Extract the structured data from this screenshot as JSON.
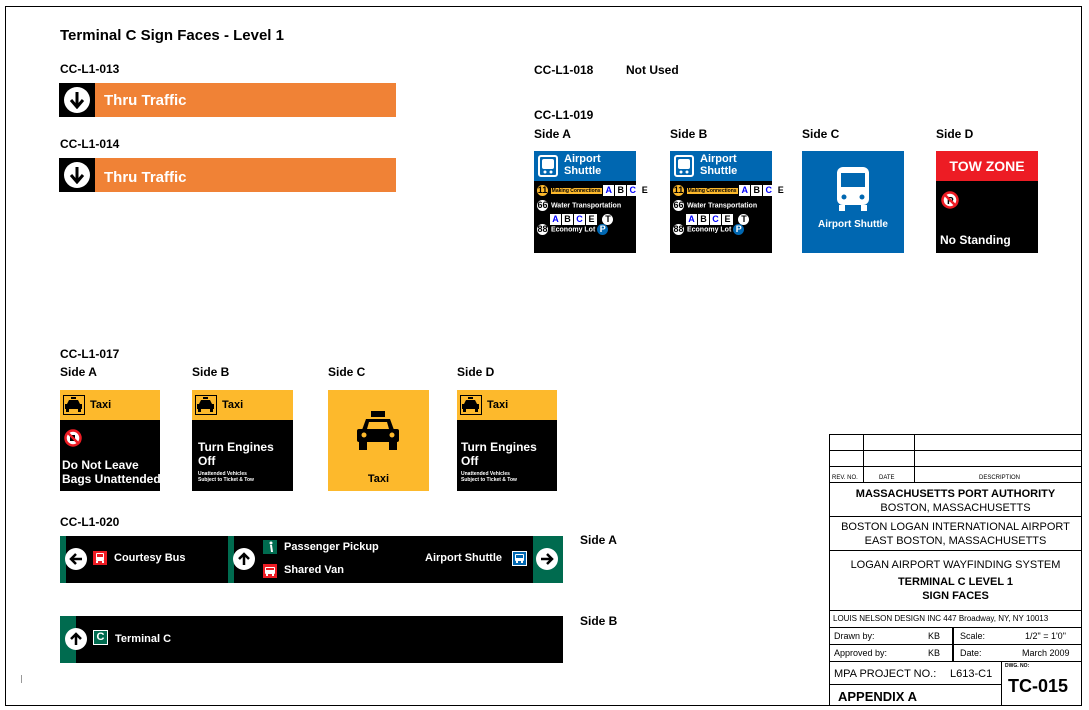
{
  "page_title": "Terminal C Sign Faces - Level 1",
  "signs": {
    "s013": {
      "code": "CC-L1-013",
      "text": "Thru Traffic"
    },
    "s014": {
      "code": "CC-L1-014",
      "text": "Thru Traffic"
    },
    "s018": {
      "code": "CC-L1-018",
      "note": "Not Used"
    },
    "s019": {
      "code": "CC-L1-019",
      "side_a": {
        "label": "Side A",
        "header": "Airport Shuttle",
        "line1_route": "11",
        "line1_brand": "Making Connections",
        "line2_route": "66",
        "line2_text": "Water Transportation",
        "line3_route": "88",
        "line3_text": "Economy Lot"
      },
      "side_b": {
        "label": "Side B",
        "header": "Airport Shuttle",
        "line1_route": "11",
        "line1_brand": "Making Connections",
        "line2_route": "66",
        "line2_text": "Water Transportation",
        "line3_route": "88",
        "line3_text": "Economy Lot"
      },
      "side_c": {
        "label": "Side C",
        "text": "Airport Shuttle"
      },
      "side_d": {
        "label": "Side D",
        "header": "TOW ZONE",
        "text": "No Standing"
      },
      "letters": [
        "A",
        "B",
        "C",
        "E"
      ],
      "parking": "P"
    },
    "s017": {
      "code": "CC-L1-017",
      "side_a": {
        "label": "Side A",
        "header": "Taxi",
        "line1": "Do Not Leave",
        "line2": "Bags Unattended"
      },
      "side_b": {
        "label": "Side B",
        "header": "Taxi",
        "line1": "Turn Engines",
        "line2": "Off",
        "small1": "Unattended Vehicles",
        "small2": "Subject to Ticket & Tow"
      },
      "side_c": {
        "label": "Side C",
        "text": "Taxi"
      },
      "side_d": {
        "label": "Side D",
        "header": "Taxi",
        "line1": "Turn Engines",
        "line2": "Off",
        "small1": "Unattended Vehicles",
        "small2": "Subject to Ticket & Tow"
      }
    },
    "s020": {
      "code": "CC-L1-020",
      "side_a_label": "Side A",
      "side_b_label": "Side B",
      "courtesy_bus": "Courtesy Bus",
      "passenger_pickup": "Passenger Pickup",
      "shared_van": "Shared Van",
      "airport_shuttle": "Airport Shuttle",
      "terminal_letter": "C",
      "terminal": "Terminal C"
    }
  },
  "title_block": {
    "rev_no": "REV. NO.",
    "date": "DATE",
    "description": "DESCRIPTION",
    "org": "MASSACHUSETTS PORT AUTHORITY",
    "org_city": "BOSTON, MASSACHUSETTS",
    "airport": "BOSTON LOGAN INTERNATIONAL AIRPORT",
    "airport_city": "EAST BOSTON, MASSACHUSETTS",
    "system": "LOGAN AIRPORT WAYFINDING SYSTEM",
    "sheet_title1": "TERMINAL C LEVEL 1",
    "sheet_title2": "SIGN FACES",
    "designer": "LOUIS NELSON DESIGN INC  447 Broadway, NY, NY 10013",
    "drawn_by_label": "Drawn by:",
    "drawn_by": "KB",
    "scale_label": "Scale:",
    "scale": "1/2\" = 1'0\"",
    "approved_by_label": "Approved by:",
    "approved_by": "KB",
    "date_label": "Date:",
    "date_value": "March 2009",
    "project_label": "MPA PROJECT NO.:",
    "project_no": "L613-C1",
    "dwg_label": "DWG. NO:",
    "dwg_no": "TC-015",
    "appendix": "APPENDIX A"
  },
  "colors": {
    "orange": "#f08236",
    "blue": "#0067b1",
    "yellow": "#fdb92c",
    "green": "#006b4f",
    "red": "#ed1c24"
  }
}
